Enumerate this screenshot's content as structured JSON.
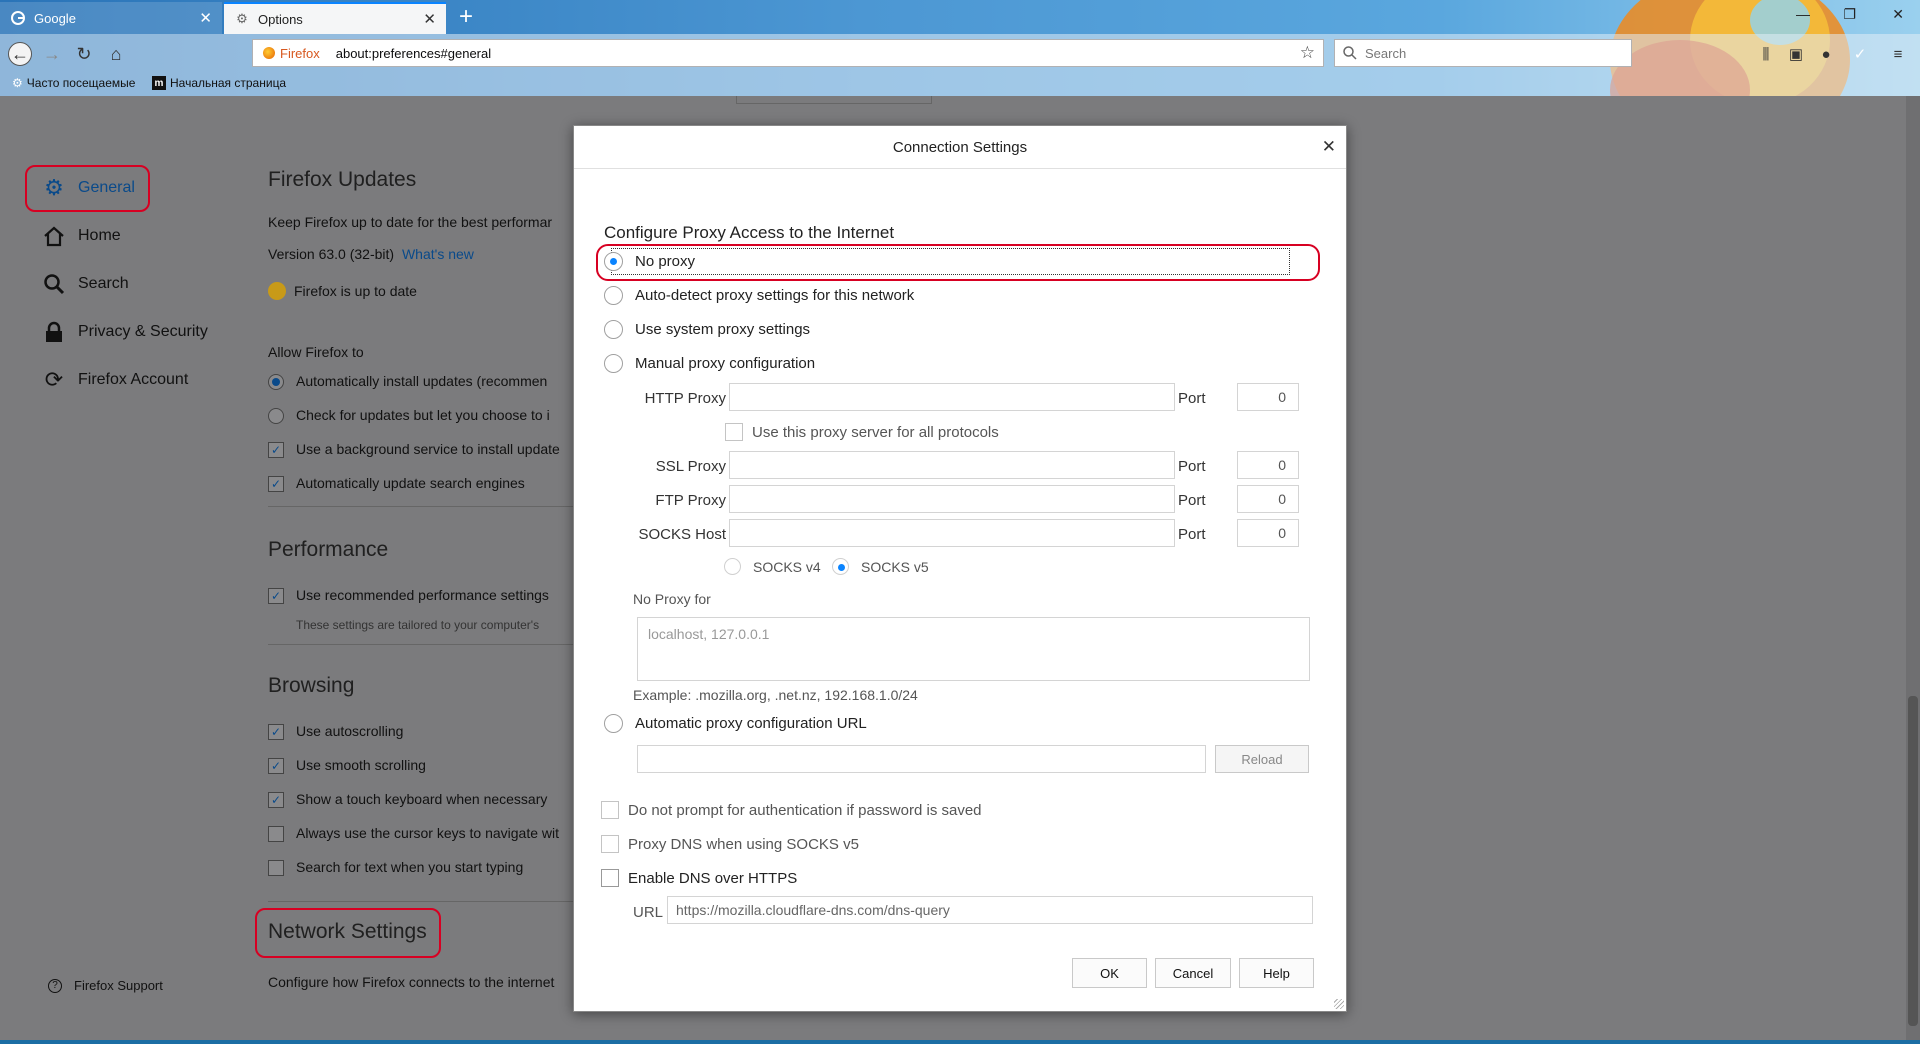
{
  "browser": {
    "tabs": [
      {
        "title": "Google",
        "favicon": "google-g-icon",
        "active": false
      },
      {
        "title": "Options",
        "favicon": "gear-icon",
        "active": true
      }
    ],
    "url": "about:preferences#general",
    "identity_label": "Firefox",
    "search_placeholder": "Search",
    "bookmarks": [
      {
        "label": "Часто посещаемые",
        "icon": "gear-icon"
      },
      {
        "label": "Начальная страница",
        "icon": "m-logo-icon"
      }
    ]
  },
  "prefs": {
    "categories": [
      {
        "label": "General",
        "icon": "gear-icon",
        "selected": true
      },
      {
        "label": "Home",
        "icon": "home-icon",
        "selected": false
      },
      {
        "label": "Search",
        "icon": "search-icon",
        "selected": false
      },
      {
        "label": "Privacy & Security",
        "icon": "lock-icon",
        "selected": false
      },
      {
        "label": "Firefox Account",
        "icon": "sync-icon",
        "selected": false
      }
    ],
    "support_label": "Firefox Support",
    "updates": {
      "heading": "Firefox Updates",
      "desc": "Keep Firefox up to date for the best performar",
      "version": "Version 63.0 (32-bit)",
      "whats_new": "What's new",
      "status": "Firefox is up to date",
      "allow_label": "Allow Firefox to",
      "auto_install": "Automatically install updates (recommen",
      "check_only": "Check for updates but let you choose to i",
      "background_service": "Use a background service to install update",
      "search_engines": "Automatically update search engines"
    },
    "performance": {
      "heading": "Performance",
      "recommended": "Use recommended performance settings",
      "note": "These settings are tailored to your computer's"
    },
    "browsing": {
      "heading": "Browsing",
      "autoscroll": "Use autoscrolling",
      "smooth": "Use smooth scrolling",
      "touch_keyboard": "Show a touch keyboard when necessary",
      "cursor_keys": "Always use the cursor keys to navigate wit",
      "search_typing": "Search for text when you start typing"
    },
    "network": {
      "heading": "Network Settings",
      "desc": "Configure how Firefox connects to the internet"
    }
  },
  "dialog": {
    "title": "Connection Settings",
    "heading": "Configure Proxy Access to the Internet",
    "options": {
      "no_proxy": "No proxy",
      "auto_detect": "Auto-detect proxy settings for this network",
      "system": "Use system proxy settings",
      "manual": "Manual proxy configuration",
      "auto_url": "Automatic proxy configuration URL"
    },
    "selected_option": "no_proxy",
    "http_proxy_label": "HTTP Proxy",
    "ssl_proxy_label": "SSL Proxy",
    "ftp_proxy_label": "FTP Proxy",
    "socks_host_label": "SOCKS Host",
    "port_label": "Port",
    "port_value": "0",
    "same_proxy_label": "Use this proxy server for all protocols",
    "socks_v4": "SOCKS v4",
    "socks_v5": "SOCKS v5",
    "no_proxy_for_label": "No Proxy for",
    "no_proxy_for_placeholder": "localhost, 127.0.0.1",
    "example": "Example: .mozilla.org, .net.nz, 192.168.1.0/24",
    "reload_button": "Reload",
    "no_auth_prompt": "Do not prompt for authentication if password is saved",
    "proxy_dns": "Proxy DNS when using SOCKS v5",
    "dns_over_https": "Enable DNS over HTTPS",
    "url_label": "URL",
    "doh_url": "https://mozilla.cloudflare-dns.com/dns-query",
    "ok_button": "OK",
    "cancel_button": "Cancel",
    "help_button": "Help"
  },
  "colors": {
    "accent": "#0a84ff",
    "highlight_annotation": "#d70022",
    "overlay": "#7b7b7d"
  }
}
